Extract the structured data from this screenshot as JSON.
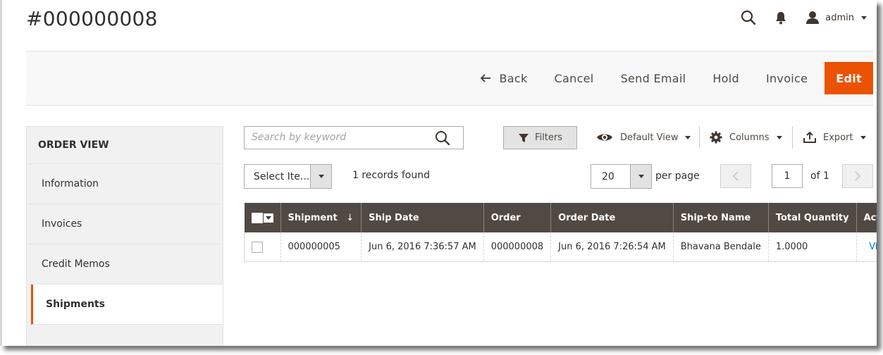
{
  "header": {
    "title": "#000000008",
    "user": "admin",
    "icons": [
      "search-icon",
      "bell-icon",
      "user-icon"
    ]
  },
  "actions": {
    "back": "Back",
    "cancel": "Cancel",
    "send_email": "Send Email",
    "hold": "Hold",
    "invoice": "Invoice",
    "edit": "Edit"
  },
  "sidebar": {
    "title": "ORDER VIEW",
    "items": [
      {
        "label": "Information"
      },
      {
        "label": "Invoices"
      },
      {
        "label": "Credit Memos"
      },
      {
        "label": "Shipments",
        "active": true
      }
    ]
  },
  "toolbar": {
    "search_placeholder": "Search by keyword",
    "filters": "Filters",
    "default_view": "Default View",
    "columns": "Columns",
    "export": "Export"
  },
  "grid_controls": {
    "mass_action": "Select Ite...",
    "records_found": "1 records found",
    "per_page_value": "20",
    "per_page_label": "per page",
    "page_value": "1",
    "of_pages": "of 1"
  },
  "table": {
    "columns": [
      "Shipment",
      "Ship Date",
      "Order",
      "Order Date",
      "Ship-to Name",
      "Total Quantity",
      "Action"
    ],
    "sort_indicator": "↓",
    "rows": [
      {
        "shipment": "000000005",
        "ship_date": "Jun 6, 2016 7:36:57 AM",
        "order": "000000008",
        "order_date": "Jun 6, 2016 7:26:54 AM",
        "ship_to_name": "Bhavana Bendale",
        "total_quantity": "1.0000",
        "action": "View"
      }
    ]
  },
  "colors": {
    "accent": "#eb5202",
    "table_header": "#514943",
    "link": "#007bdb"
  }
}
